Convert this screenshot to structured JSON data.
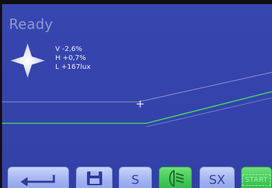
{
  "status": {
    "text": "Ready"
  },
  "readouts": {
    "vertical": "V -2,6%",
    "horizontal": "H +0,7%",
    "luminance": "L +167lux"
  },
  "toolbar": {
    "back_icon": "back-arrow-icon",
    "save_icon": "save-disk-icon",
    "s_label": "S",
    "headlight_icon": "headlight-beam-icon",
    "sx_label": "SX",
    "start_label": "START"
  },
  "colors": {
    "screen_bg": "#3544ac",
    "status_text": "#8e9bd3",
    "cutoff_line": "#9aa6dc",
    "reference_line": "#41d36a",
    "button_blue": "#a8b8f2",
    "button_green": "#3fc553"
  }
}
